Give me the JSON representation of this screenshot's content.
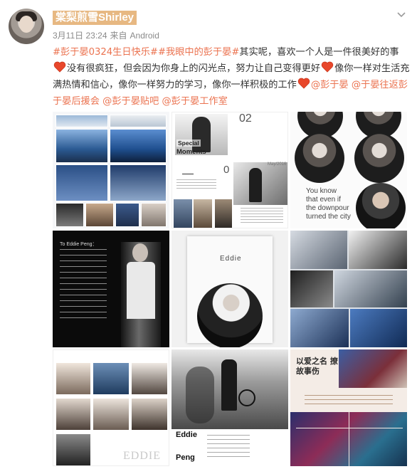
{
  "user": {
    "name": "棠梨煎雪Shirley",
    "avatar_icon": "avatar-photo"
  },
  "meta": {
    "time": "3月11日 23:24",
    "source_prefix": "来自",
    "source": "Android"
  },
  "post": {
    "tag1": "#彭于晏0324生日快乐#",
    "tag2": "#我眼中的彭于晏#",
    "seg1": "其实呢，喜欢一个人是一件很美好的事",
    "seg2": "没有很疯狂，但会因为你身上的闪光点，努力让自己变得更好",
    "seg3": "像你一样对生活充满热情和信心，像你一样努力的学习，像你一样积极的工作",
    "mention1": "@彭于晏",
    "mention2": "@于晏往返彭于晏后援会",
    "mention3": "@彭于晏贴吧",
    "mention4": "@彭于晏工作室",
    "heart_color": "#e8472b",
    "link_color": "#eb7350"
  },
  "images": {
    "c2_num": "02",
    "c2_title1": "Special",
    "c2_title2": "Moments",
    "c2_num2": "0",
    "c2_date": "May/2016",
    "c3_quote1": "You know",
    "c3_quote2": "that even if",
    "c3_quote3": "the downpour",
    "c3_quote4": "turned the city",
    "c4_heading": "To Eddie Peng：",
    "c5_name": "Eddie",
    "c7_name": "EDDIE",
    "c8_name1": "Eddie",
    "c8_name2": "Peng",
    "c9_title": "以爱之名 撩故事伤"
  }
}
